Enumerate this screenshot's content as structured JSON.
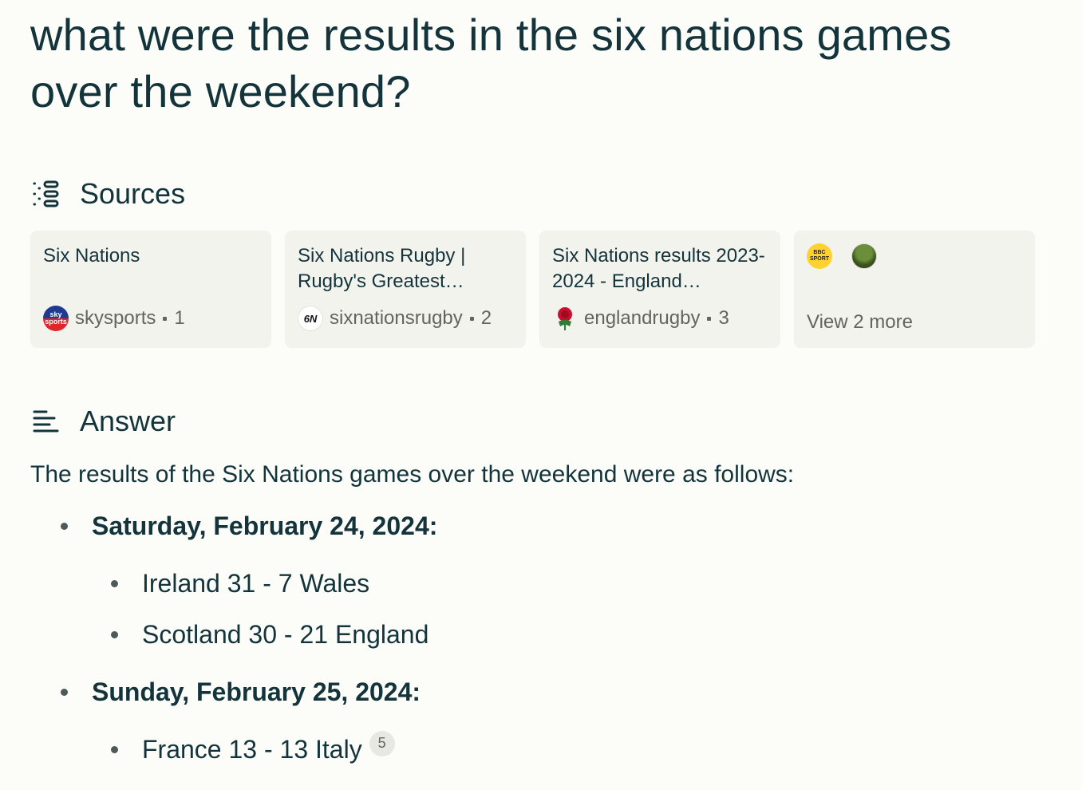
{
  "query": "what were the results in the six nations games over the weekend?",
  "sources": {
    "heading": "Sources",
    "cards": [
      {
        "title": "Six Nations",
        "site": "skysports",
        "index": "1",
        "icon": "skysports-icon"
      },
      {
        "title": "Six Nations Rugby | Rugby's Greatest…",
        "site": "sixnationsrugby",
        "index": "2",
        "icon": "sixnations-icon"
      },
      {
        "title": "Six Nations results 2023-2024 - England…",
        "site": "englandrugby",
        "index": "3",
        "icon": "england-rose-icon"
      }
    ],
    "more": {
      "label": "View 2 more",
      "icons": [
        "bbc-sport-icon",
        "photo-thumbnail-icon"
      ]
    },
    "favicon_text": {
      "sky_top": "sky",
      "sky_bottom": "sports",
      "sixn": "6N",
      "bbc_top": "BBC",
      "bbc_bottom": "SPORT"
    }
  },
  "answer": {
    "heading": "Answer",
    "intro": "The results of the Six Nations games over the weekend were as follows:",
    "days": [
      {
        "label": "Saturday, February 24, 2024:",
        "results": [
          "Ireland 31 - 7 Wales",
          "Scotland 30 - 21 England"
        ]
      },
      {
        "label": "Sunday, February 25, 2024:",
        "results": [
          "France 13 - 13 Italy"
        ],
        "citation": "5"
      }
    ]
  },
  "colors": {
    "background": "#fcfcf9",
    "text": "#13343b",
    "card": "#f3f3ee",
    "muted": "#64645f"
  }
}
